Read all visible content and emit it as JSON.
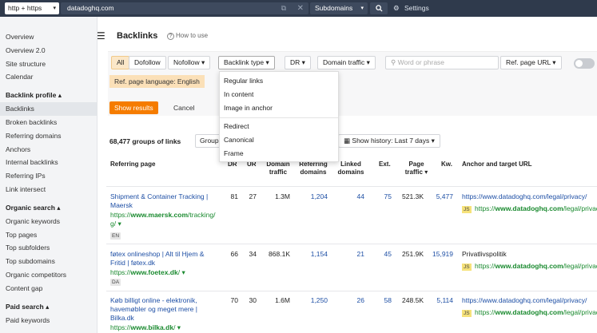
{
  "topbar": {
    "protocol": "http + https",
    "url": "datadoghq.com",
    "mode": "Subdomains",
    "settings": "Settings"
  },
  "sidebar": {
    "items_top": [
      "Overview",
      "Overview 2.0",
      "Site structure",
      "Calendar"
    ],
    "backlink_profile": "Backlink profile",
    "backlink_items": [
      "Backlinks",
      "Broken backlinks",
      "Referring domains",
      "Anchors",
      "Internal backlinks",
      "Referring IPs",
      "Link intersect"
    ],
    "organic_search": "Organic search",
    "organic_items": [
      "Organic keywords",
      "Top pages",
      "Top subfolders",
      "Top subdomains",
      "Organic competitors",
      "Content gap"
    ],
    "paid_search": "Paid search",
    "paid_items": [
      "Paid keywords"
    ]
  },
  "main": {
    "title": "Backlinks",
    "how_to": "How to use",
    "filters": {
      "all": "All",
      "dofollow": "Dofollow",
      "nofollow": "Nofollow",
      "backlink_type": "Backlink type",
      "dr": "DR",
      "domain_traffic": "Domain traffic",
      "search_placeholder": "Word or phrase",
      "ref_page_url": "Ref. page URL"
    },
    "chip": "Ref. page language: English",
    "show_results": "Show results",
    "cancel": "Cancel",
    "dropdown": [
      "Regular links",
      "In content",
      "Image in anchor",
      "Redirect",
      "Canonical",
      "Frame"
    ],
    "groups_count": "68,477 groups of links",
    "group_btn": "Group",
    "history_btn": "Show history: Last 7 days"
  },
  "table": {
    "headers": {
      "referring_page": "Referring page",
      "dr": "DR",
      "ur": "UR",
      "domain_traffic": "Domain traffic",
      "referring_domains": "Referring domains",
      "linked_domains": "Linked domains",
      "ext": "Ext.",
      "page_traffic": "Page traffic",
      "kw": "Kw.",
      "anchor": "Anchor and target URL"
    },
    "rows": [
      {
        "title": "Shipment & Container Tracking | Maersk",
        "url_prefix": "https://",
        "url_bold": "www.maersk.com",
        "url_rest": "/tracking/",
        "lang": "EN",
        "dr": "81",
        "ur": "27",
        "domain_traffic": "1.3M",
        "ref_domains": "1,204",
        "linked_domains": "44",
        "ext": "75",
        "page_traffic": "521.3K",
        "kw": "5,477",
        "anchor_url": "https://www.datadoghq.com/legal/privacy/",
        "target_prefix": "https://",
        "target_bold": "www.datadoghq.com",
        "target_rest": "/legal/privacy/"
      },
      {
        "title": "føtex onlineshop | Alt til Hjem & Fritid | føtex.dk",
        "url_prefix": "https://",
        "url_bold": "www.foetex.dk",
        "url_rest": "/",
        "lang": "DA",
        "dr": "66",
        "ur": "34",
        "domain_traffic": "868.1K",
        "ref_domains": "1,154",
        "linked_domains": "21",
        "ext": "45",
        "page_traffic": "251.9K",
        "kw": "15,919",
        "anchor_url": "Privatlivspolitik",
        "target_prefix": "https://",
        "target_bold": "www.datadoghq.com",
        "target_rest": "/legal/privacy/"
      },
      {
        "title": "Køb billigt online - elektronik, havemøbler og meget mere | Bilka.dk",
        "url_prefix": "https://",
        "url_bold": "www.bilka.dk",
        "url_rest": "/",
        "lang": "",
        "dr": "70",
        "ur": "30",
        "domain_traffic": "1.6M",
        "ref_domains": "1,250",
        "linked_domains": "26",
        "ext": "58",
        "page_traffic": "248.5K",
        "kw": "5,114",
        "anchor_url": "https://www.datadoghq.com/legal/privacy/",
        "target_prefix": "https://",
        "target_bold": "www.datadoghq.com",
        "target_rest": "/legal/privacy/"
      }
    ]
  }
}
